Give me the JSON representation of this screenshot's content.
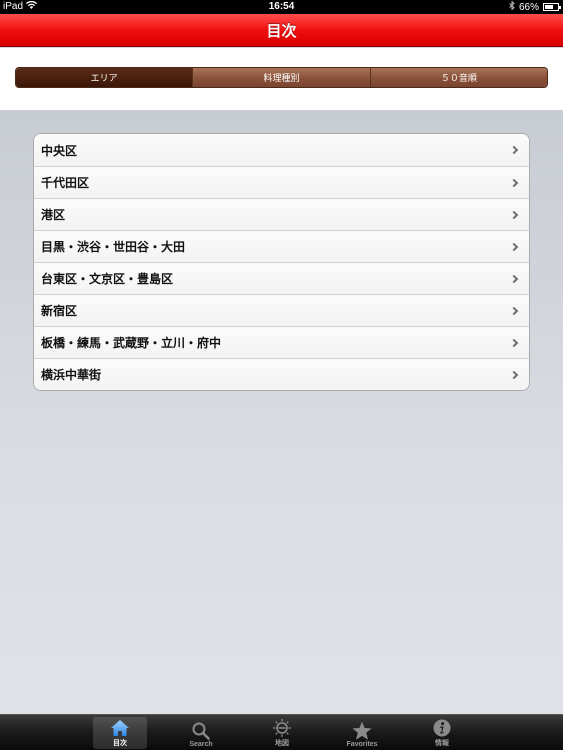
{
  "status_bar": {
    "device": "iPad",
    "time": "16:54",
    "battery": "66%",
    "battery_level": 0.66
  },
  "nav_bar": {
    "title": "目次"
  },
  "segments": [
    {
      "label": "エリア",
      "selected": true
    },
    {
      "label": "料理種別",
      "selected": false
    },
    {
      "label": "５０音順",
      "selected": false
    }
  ],
  "list": {
    "items": [
      {
        "label": "中央区"
      },
      {
        "label": "千代田区"
      },
      {
        "label": "港区"
      },
      {
        "label": "目黒・渋谷・世田谷・大田"
      },
      {
        "label": "台東区・文京区・豊島区"
      },
      {
        "label": "新宿区"
      },
      {
        "label": "板橋・練馬・武蔵野・立川・府中"
      },
      {
        "label": "横浜中華街"
      }
    ]
  },
  "tab_bar": {
    "tabs": [
      {
        "label": "目次",
        "icon": "home-icon",
        "selected": true
      },
      {
        "label": "Search",
        "icon": "search-icon",
        "selected": false
      },
      {
        "label": "地図",
        "icon": "map-icon",
        "selected": false
      },
      {
        "label": "Favorites",
        "icon": "star-icon",
        "selected": false
      },
      {
        "label": "情報",
        "icon": "info-icon",
        "selected": false
      }
    ]
  },
  "colors": {
    "nav_red": "#f01010",
    "segment_brown": "#8a5139",
    "segment_selected": "#4a200f",
    "tab_selected_icon": "#4fa8ff"
  }
}
